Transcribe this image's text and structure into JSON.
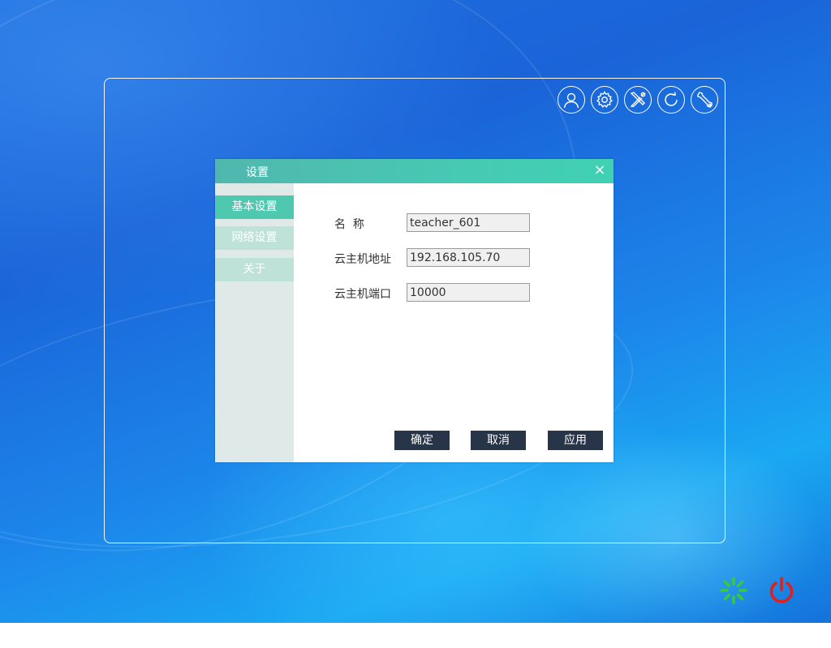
{
  "toolbar": {
    "icons": [
      "user-icon",
      "gear-icon",
      "tools-icon",
      "refresh-icon",
      "wrench-icon"
    ]
  },
  "dialog": {
    "title": "设置",
    "close_glyph": "×",
    "sidebar": {
      "items": [
        {
          "label": "基本设置",
          "active": true
        },
        {
          "label": "网络设置",
          "active": false
        },
        {
          "label": "关于",
          "active": false
        }
      ]
    },
    "form": {
      "name_label": "名  称",
      "name_value": "teacher_601",
      "host_label": "云主机地址",
      "host_value": "192.168.105.70",
      "port_label": "云主机端口",
      "port_value": "10000"
    },
    "buttons": {
      "ok": "确定",
      "cancel": "取消",
      "apply": "应用"
    }
  },
  "colors": {
    "titlebar": "#47c9b4",
    "sidebar_active": "#4ec9b0",
    "sidebar_inactive": "#bfe2d8",
    "button": "#283447",
    "loading": "#3cc83c",
    "power": "#e02020"
  }
}
